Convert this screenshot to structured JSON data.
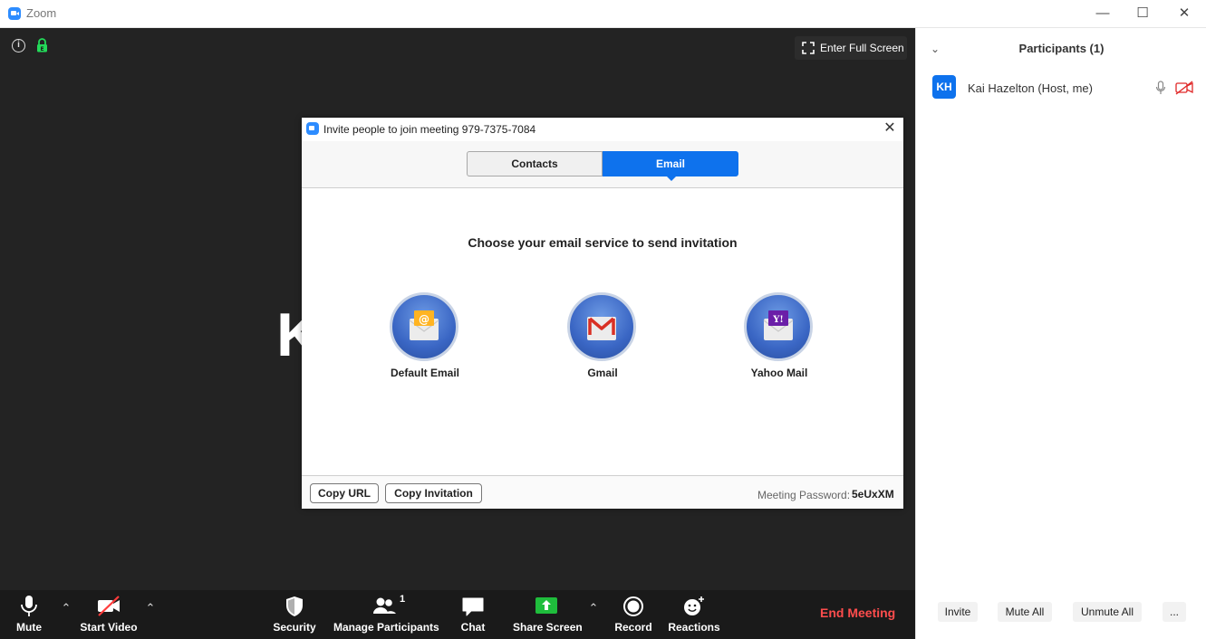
{
  "window": {
    "title": "Zoom",
    "minimize_icon": "minimize-icon",
    "maximize_icon": "maximize-icon",
    "close_icon": "close-icon"
  },
  "meeting": {
    "full_screen_label": "Enter Full Screen",
    "speaker_initial": "K",
    "end_meeting_label": "End Meeting"
  },
  "toolbar": {
    "mute": "Mute",
    "start_video": "Start Video",
    "security": "Security",
    "manage_participants": "Manage Participants",
    "participant_count": "1",
    "chat": "Chat",
    "share_screen": "Share Screen",
    "record": "Record",
    "reactions": "Reactions"
  },
  "participants_panel": {
    "title": "Participants (1)",
    "participants": [
      {
        "initials": "KH",
        "name": "Kai Hazelton (Host, me)"
      }
    ],
    "buttons": {
      "invite": "Invite",
      "mute_all": "Mute All",
      "unmute_all": "Unmute All",
      "more": "..."
    }
  },
  "invite_dialog": {
    "title": "Invite people to join meeting 979-7375-7084",
    "tabs": {
      "contacts": "Contacts",
      "email": "Email"
    },
    "active_tab": "Email",
    "heading": "Choose your email service to send invitation",
    "services": [
      {
        "label": "Default Email",
        "icon": "default-email-icon"
      },
      {
        "label": "Gmail",
        "icon": "gmail-icon"
      },
      {
        "label": "Yahoo Mail",
        "icon": "yahoo-mail-icon"
      }
    ],
    "copy_url": "Copy URL",
    "copy_invitation": "Copy Invitation",
    "password_label": "Meeting Password:",
    "password_value": "5eUxXM"
  },
  "colors": {
    "accent": "#0e72ed",
    "end_meeting": "#ff4d4d",
    "meeting_bg": "#232323",
    "toolbar_bg": "#1a1a1a",
    "share_green": "#1fbd3c"
  }
}
